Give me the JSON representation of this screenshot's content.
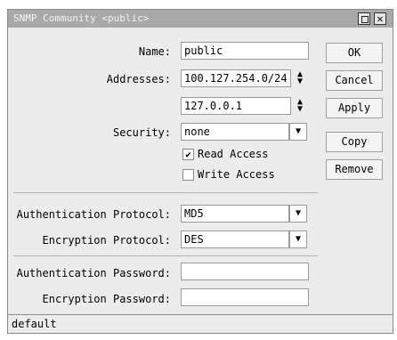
{
  "window": {
    "title": "SNMP Community <public>",
    "restore_icon": "restore-icon",
    "close_glyph": "✕"
  },
  "form": {
    "name": {
      "label": "Name:",
      "value": "public"
    },
    "addresses": {
      "label": "Addresses:",
      "values": [
        "100.127.254.0/24",
        "127.0.0.1"
      ]
    },
    "security": {
      "label": "Security:",
      "value": "none",
      "options_visible": [
        "none"
      ]
    },
    "read_access": {
      "label": "Read Access",
      "checked": true
    },
    "write_access": {
      "label": "Write Access",
      "checked": false
    },
    "auth_protocol": {
      "label": "Authentication Protocol:",
      "value": "MD5"
    },
    "enc_protocol": {
      "label": "Encryption Protocol:",
      "value": "DES"
    },
    "auth_password": {
      "label": "Authentication Password:",
      "value": ""
    },
    "enc_password": {
      "label": "Encryption Password:",
      "value": ""
    }
  },
  "buttons": {
    "ok": "OK",
    "cancel": "Cancel",
    "apply": "Apply",
    "copy": "Copy",
    "remove": "Remove"
  },
  "status": {
    "text": "default"
  },
  "glyphs": {
    "spinner": "◆",
    "dropdown": "▼",
    "check": "✔"
  }
}
